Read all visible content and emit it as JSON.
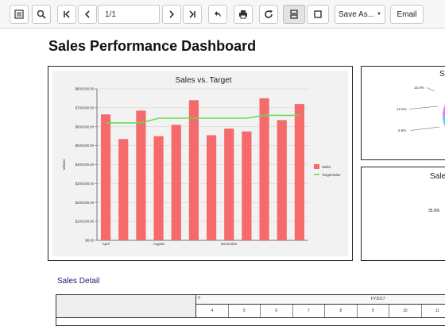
{
  "toolbar": {
    "page_value": "1/1",
    "save_as_label": "Save As...",
    "email_label": "Email"
  },
  "page": {
    "title": "Sales Performance Dashboard"
  },
  "chart_data": [
    {
      "type": "bar",
      "title": "Sales vs. Target",
      "xlabel": "",
      "ylabel": "Values",
      "ylim": [
        0,
        800000
      ],
      "yticks": [
        "$0.00",
        "$100,000.00",
        "$200,000.00",
        "$300,000.00",
        "$400,000.00",
        "$500,000.00",
        "$600,000.00",
        "$700,000.00",
        "$800,000.00"
      ],
      "categories": [
        "April",
        "",
        "",
        "August",
        "",
        "",
        "",
        "December",
        "",
        "",
        "",
        ""
      ],
      "x_tick_labels": [
        "April",
        "August",
        "December"
      ],
      "grid": true,
      "legend_position": "right",
      "series": [
        {
          "name": "Sales",
          "type": "bar",
          "color": "#f56a6a",
          "values": [
            665000,
            535000,
            685000,
            550000,
            610000,
            740000,
            555000,
            590000,
            575000,
            750000,
            635000,
            720000
          ]
        },
        {
          "name": "TargetValue",
          "type": "line",
          "color": "#66dd55",
          "values": [
            620000,
            620000,
            620000,
            645000,
            645000,
            645000,
            645000,
            645000,
            645000,
            660000,
            660000,
            660000
          ]
        }
      ]
    },
    {
      "type": "pie",
      "title": "S",
      "labels": [
        "15.0%",
        "12.5%",
        "6.8%"
      ],
      "values": [
        15.0,
        12.5,
        6.8
      ],
      "colors": [
        "#c8a77a",
        "#ff66ff",
        "#66ccff",
        "#f5f56a"
      ]
    },
    {
      "type": "pie",
      "title": "Sale",
      "labels": [
        "35.8%"
      ],
      "values": [
        35.8
      ],
      "colors": [
        "#6666ee",
        "#66dd55"
      ]
    }
  ],
  "detail": {
    "title": "Sales Detail",
    "fy_marker": "0",
    "fy_label": "FY2017",
    "months": [
      "4",
      "5",
      "6",
      "7",
      "8",
      "9",
      "10",
      "11"
    ]
  }
}
